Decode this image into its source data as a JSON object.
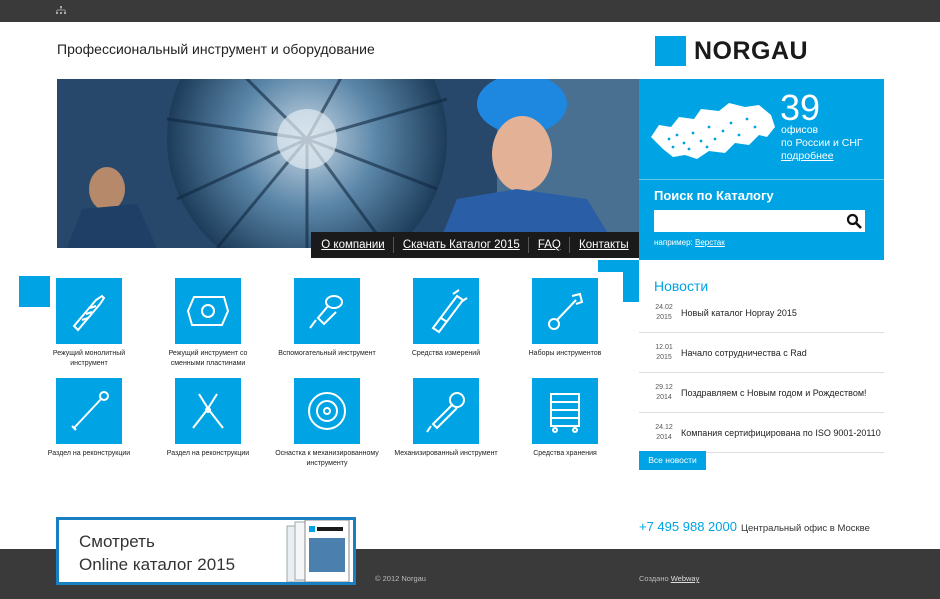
{
  "header": {
    "tagline": "Профессиональный инструмент и оборудование",
    "logo_text": "NORGAU"
  },
  "nav": {
    "items": [
      "О компании",
      "Скачать Каталог 2015",
      "FAQ",
      "Контакты"
    ]
  },
  "offices": {
    "count": "39",
    "line1": "офисов",
    "line2": "по России и СНГ",
    "link": "подробнее"
  },
  "search": {
    "title": "Поиск по Каталогу",
    "hint_prefix": "например:",
    "hint_link": "Верстак"
  },
  "news": {
    "title": "Новости",
    "items": [
      {
        "day": "24.02",
        "year": "2015",
        "text": "Новый каталог Hopray 2015"
      },
      {
        "day": "12.01",
        "year": "2015",
        "text": "Начало сотрудничества с Rad"
      },
      {
        "day": "29.12",
        "year": "2014",
        "text": "Поздравляем с Новым годом и Рождеством!"
      },
      {
        "day": "24.12",
        "year": "2014",
        "text": "Компания сертифицирована по ISO 9001-20110"
      }
    ],
    "all_label": "Все новости"
  },
  "categories": [
    {
      "label": "Режущий монолитный инструмент",
      "icon": "drill-bit-icon"
    },
    {
      "label": "Режущий инструмент со сменными пластинами",
      "icon": "insert-plate-icon"
    },
    {
      "label": "Вспомогательный инструмент",
      "icon": "tool-holder-icon"
    },
    {
      "label": "Средства измерений",
      "icon": "caliper-icon"
    },
    {
      "label": "Наборы инструментов",
      "icon": "wrench-icon"
    },
    {
      "label": "Раздел на реконструкции",
      "icon": "torque-wrench-icon"
    },
    {
      "label": "Раздел на реконструкции",
      "icon": "pliers-icon"
    },
    {
      "label": "Оснастка к механизированному инструменту",
      "icon": "grinding-disc-icon"
    },
    {
      "label": "Механизированный инструмент",
      "icon": "angle-grinder-icon"
    },
    {
      "label": "Средства хранения",
      "icon": "tool-cabinet-icon"
    }
  ],
  "contact": {
    "phone": "+7 495 988 2000",
    "text": "Центральный офис в Москве"
  },
  "catalog_banner": {
    "line1": "Смотреть",
    "line2": "Online каталог 2015"
  },
  "footer": {
    "copyright": "© 2012 Norgau",
    "created_prefix": "Создано",
    "created_link": "Webway"
  },
  "colors": {
    "accent": "#00a4e4",
    "dark": "#3a3a3a"
  }
}
